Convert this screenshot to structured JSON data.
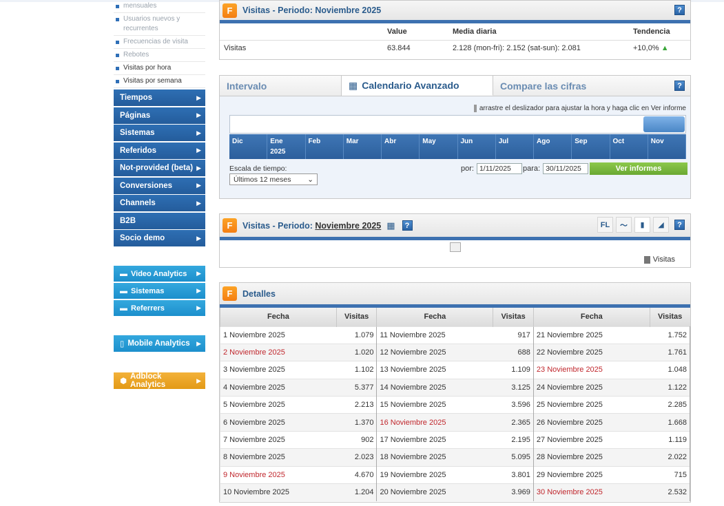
{
  "sidebar": {
    "sub_items": [
      {
        "label": "mensuales",
        "dark": false
      },
      {
        "label": "Usuarios nuevos y recurrentes",
        "dark": false
      },
      {
        "label": "Frecuencias de visita",
        "dark": false
      },
      {
        "label": "Rebotes",
        "dark": false
      },
      {
        "label": "Visitas por hora",
        "dark": true
      },
      {
        "label": "Visitas por semana",
        "dark": true
      }
    ],
    "nav": [
      "Tiempos",
      "Páginas",
      "Sistemas",
      "Referidos",
      "Not-provided (beta)",
      "Conversiones",
      "Channels",
      "B2B",
      "Socio demo"
    ],
    "plus": [
      "Video Analytics",
      "Sistemas",
      "Referrers"
    ],
    "mobile": "Mobile Analytics",
    "adblock": "Adblock Analytics"
  },
  "summary": {
    "title": "Visitas - Periodo: Noviembre 2025",
    "headers": {
      "value": "Value",
      "daily": "Media diaria",
      "trend": "Tendencia"
    },
    "row": {
      "label": "Visitas",
      "value": "63.844",
      "daily": "2.128  (mon-fri): 2.152  (sat-sun): 2.081",
      "trend": "+10,0%"
    }
  },
  "calendar": {
    "tabs": [
      "Intervalo",
      "Calendario Avanzado",
      "Compare las cifras"
    ],
    "hint": "arrastre el deslizador para ajustar la hora y haga clic en Ver informe",
    "months": [
      {
        "m": "Dic",
        "y": ""
      },
      {
        "m": "Ene",
        "y": "2025"
      },
      {
        "m": "Feb",
        "y": ""
      },
      {
        "m": "Mar",
        "y": ""
      },
      {
        "m": "Abr",
        "y": ""
      },
      {
        "m": "May",
        "y": ""
      },
      {
        "m": "Jun",
        "y": ""
      },
      {
        "m": "Jul",
        "y": ""
      },
      {
        "m": "Ago",
        "y": ""
      },
      {
        "m": "Sep",
        "y": ""
      },
      {
        "m": "Oct",
        "y": ""
      },
      {
        "m": "Nov",
        "y": ""
      }
    ],
    "scale_label": "Escala de tiempo:",
    "scale_value": "Últimos 12 meses",
    "from_label": "por:",
    "from_value": "1/11/2025",
    "to_label": "para:",
    "to_value": "30/11/2025",
    "button": "Ver informes"
  },
  "chart": {
    "title_prefix": "Visitas - Periodo: ",
    "title_link": "Noviembre 2025",
    "fl": "FL",
    "legend": "Visitas"
  },
  "details": {
    "title": "Detalles",
    "headers": [
      "Fecha",
      "Visitas",
      "Fecha",
      "Visitas",
      "Fecha",
      "Visitas"
    ],
    "rows": [
      [
        [
          "1 Noviembre 2025",
          "1.079",
          false
        ],
        [
          "11 Noviembre 2025",
          "917",
          false
        ],
        [
          "21 Noviembre 2025",
          "1.752",
          false
        ]
      ],
      [
        [
          "2 Noviembre 2025",
          "1.020",
          true
        ],
        [
          "12 Noviembre 2025",
          "688",
          false
        ],
        [
          "22 Noviembre 2025",
          "1.761",
          false
        ]
      ],
      [
        [
          "3 Noviembre 2025",
          "1.102",
          false
        ],
        [
          "13 Noviembre 2025",
          "1.109",
          false
        ],
        [
          "23 Noviembre 2025",
          "1.048",
          true
        ]
      ],
      [
        [
          "4 Noviembre 2025",
          "5.377",
          false
        ],
        [
          "14 Noviembre 2025",
          "3.125",
          false
        ],
        [
          "24 Noviembre 2025",
          "1.122",
          false
        ]
      ],
      [
        [
          "5 Noviembre 2025",
          "2.213",
          false
        ],
        [
          "15 Noviembre 2025",
          "3.596",
          false
        ],
        [
          "25 Noviembre 2025",
          "2.285",
          false
        ]
      ],
      [
        [
          "6 Noviembre 2025",
          "1.370",
          false
        ],
        [
          "16 Noviembre 2025",
          "2.365",
          true
        ],
        [
          "26 Noviembre 2025",
          "1.668",
          false
        ]
      ],
      [
        [
          "7 Noviembre 2025",
          "902",
          false
        ],
        [
          "17 Noviembre 2025",
          "2.195",
          false
        ],
        [
          "27 Noviembre 2025",
          "1.119",
          false
        ]
      ],
      [
        [
          "8 Noviembre 2025",
          "2.023",
          false
        ],
        [
          "18 Noviembre 2025",
          "5.095",
          false
        ],
        [
          "28 Noviembre 2025",
          "2.022",
          false
        ]
      ],
      [
        [
          "9 Noviembre 2025",
          "4.670",
          true
        ],
        [
          "19 Noviembre 2025",
          "3.801",
          false
        ],
        [
          "29 Noviembre 2025",
          "715",
          false
        ]
      ],
      [
        [
          "10 Noviembre 2025",
          "1.204",
          false
        ],
        [
          "20 Noviembre 2025",
          "3.969",
          false
        ],
        [
          "30 Noviembre 2025",
          "2.532",
          true
        ]
      ]
    ]
  }
}
